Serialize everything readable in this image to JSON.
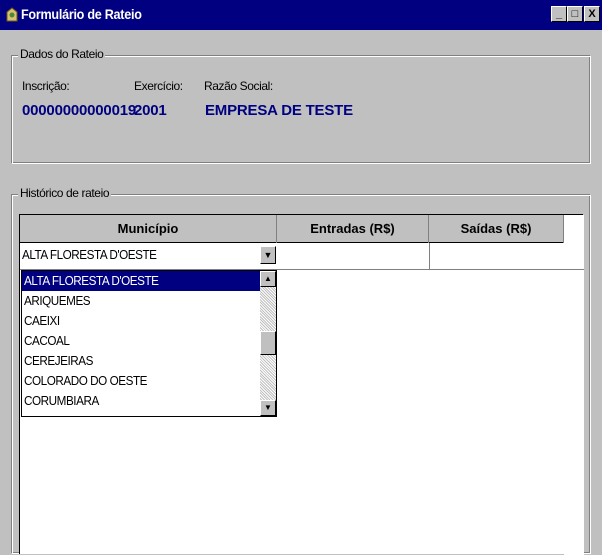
{
  "window": {
    "title": "Formulário de Rateio",
    "minimize_glyph": "_",
    "maximize_glyph": "□",
    "close_glyph": "X"
  },
  "dados": {
    "legend": "Dados do Rateio",
    "inscricao_label": "Inscrição:",
    "inscricao_value": "00000000000019",
    "exercicio_label": "Exercício:",
    "exercicio_value": "2001",
    "razao_label": "Razão Social:",
    "razao_value": "EMPRESA DE TESTE"
  },
  "historico": {
    "legend": "Histórico de rateio",
    "columns": [
      "Município",
      "Entradas (R$)",
      "Saídas (R$)"
    ],
    "combo_value": "ALTA FLORESTA D'OESTE",
    "dropdown_items": [
      "ALTA FLORESTA D'OESTE",
      "ARIQUEMES",
      "CAEIXI",
      "CACOAL",
      "CEREJEIRAS",
      "COLORADO DO OESTE",
      "CORUMBIARA"
    ],
    "selected_index": 0
  },
  "colors": {
    "titlebar": "#000080",
    "value_text": "#000080",
    "face": "#c0c0c0"
  }
}
